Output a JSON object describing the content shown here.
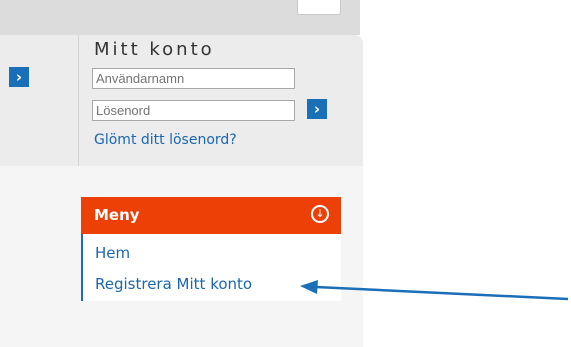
{
  "login": {
    "title": "Mitt konto",
    "username_placeholder": "Användarnamn",
    "password_placeholder": "Lösenord",
    "forgot_password": "Glömt ditt lösenord?",
    "submit_icon": "chevron-right-icon"
  },
  "side_button": {
    "icon": "chevron-right-icon"
  },
  "menu": {
    "title": "Meny",
    "toggle_icon": "arrow-down-circle-icon",
    "items": [
      {
        "label": "Hem"
      },
      {
        "label": "Registrera Mitt konto"
      }
    ]
  },
  "colors": {
    "menu_header": "#ec4007",
    "link": "#1a66b2",
    "button": "#1a70b8",
    "annotation_arrow": "#1a6fb8"
  }
}
